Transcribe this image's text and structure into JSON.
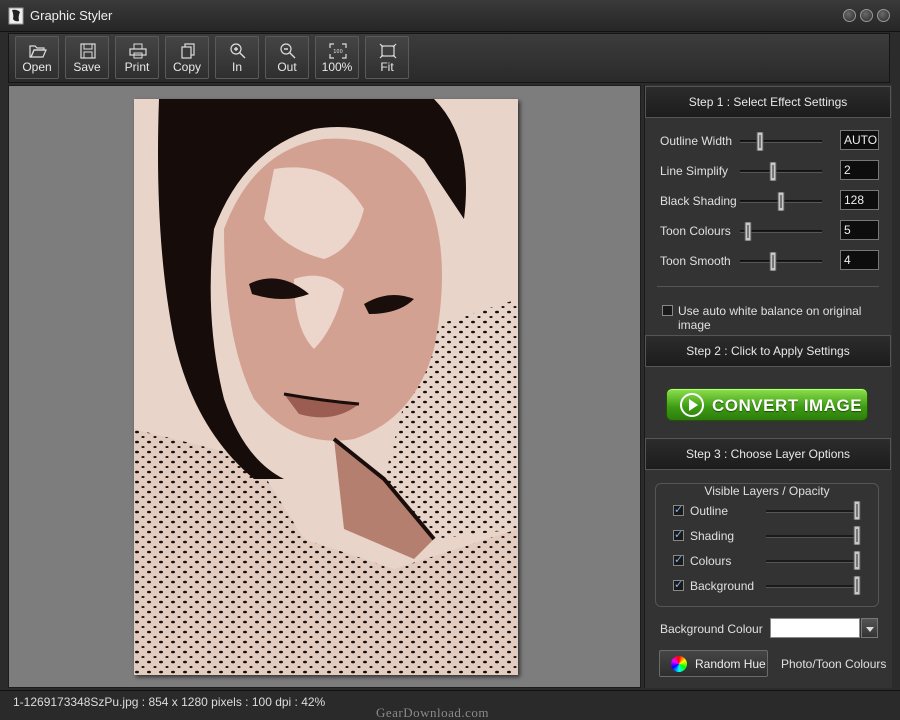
{
  "window": {
    "title": "Graphic Styler"
  },
  "toolbar": {
    "buttons": [
      {
        "id": "open",
        "label": "Open",
        "icon": "folder-open-icon"
      },
      {
        "id": "save",
        "label": "Save",
        "icon": "floppy-disk-icon"
      },
      {
        "id": "print",
        "label": "Print",
        "icon": "printer-icon"
      },
      {
        "id": "copy",
        "label": "Copy",
        "icon": "copy-icon"
      },
      {
        "id": "zoom-in",
        "label": "In",
        "icon": "zoom-in-icon"
      },
      {
        "id": "zoom-out",
        "label": "Out",
        "icon": "zoom-out-icon"
      },
      {
        "id": "zoom-100",
        "label": "100%",
        "icon": "actual-size-icon",
        "icon_text": "100"
      },
      {
        "id": "fit",
        "label": "Fit",
        "icon": "fit-to-window-icon"
      }
    ]
  },
  "step1": {
    "header": "Step 1 : Select Effect Settings",
    "sliders": [
      {
        "label": "Outline Width",
        "value": "AUTO",
        "position": 0.25
      },
      {
        "label": "Line Simplify",
        "value": "2",
        "position": 0.4
      },
      {
        "label": "Black Shading",
        "value": "128",
        "position": 0.5
      },
      {
        "label": "Toon Colours",
        "value": "5",
        "position": 0.1
      },
      {
        "label": "Toon Smooth",
        "value": "4",
        "position": 0.4
      }
    ],
    "auto_white_balance": {
      "label": "Use auto white balance on original image",
      "checked": false
    }
  },
  "step2": {
    "header": "Step 2 : Click to Apply Settings",
    "convert_label": "CONVERT IMAGE"
  },
  "step3": {
    "header": "Step 3 : Choose Layer Options",
    "layers_title": "Visible Layers / Opacity",
    "layers": [
      {
        "label": "Outline",
        "checked": true,
        "opacity": 1.0
      },
      {
        "label": "Shading",
        "checked": true,
        "opacity": 1.0
      },
      {
        "label": "Colours",
        "checked": true,
        "opacity": 1.0
      },
      {
        "label": "Background",
        "checked": true,
        "opacity": 1.0
      }
    ],
    "background_colour_label": "Background Colour",
    "background_colour": "#ffffff",
    "random_hue_label": "Random Hue",
    "photo_toon_label": "Photo/Toon Colours"
  },
  "status": {
    "text": "1-1269173348SzPu.jpg : 854 x 1280 pixels : 100 dpi : 42%",
    "watermark": "GearDownload.com"
  }
}
